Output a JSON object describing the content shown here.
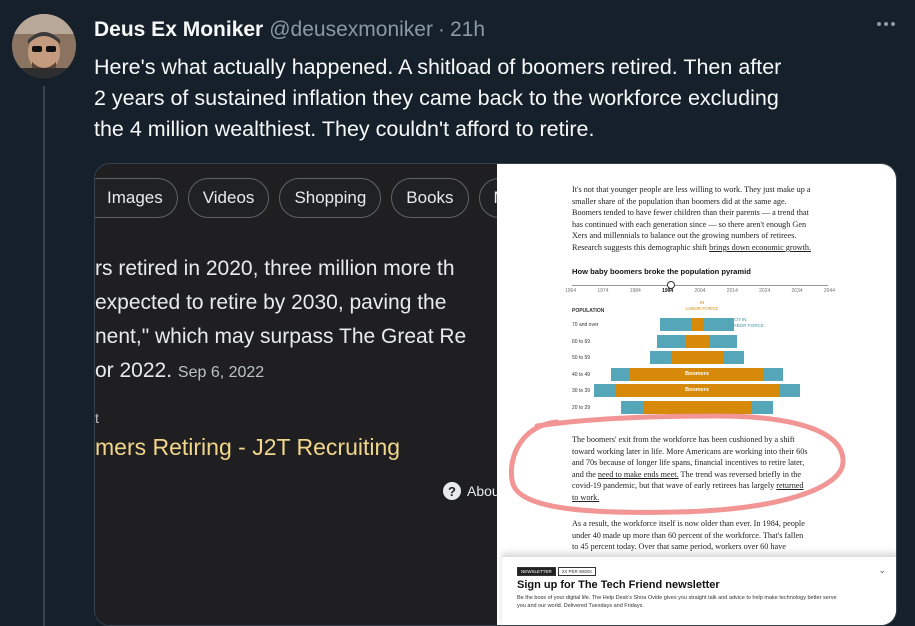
{
  "tweet": {
    "author_name": "Deus Ex Moniker",
    "handle": "@deusexmoniker",
    "separator": "·",
    "time": "21h",
    "text_lines": [
      "Here's what actually happened.  A shitload of boomers retired.  Then after",
      "2 years of sustained inflation they came back to the workforce excluding",
      "the 4 million wealthiest.  They couldn't afford to retire."
    ]
  },
  "google_panel": {
    "chips": [
      "Images",
      "Videos",
      "Shopping",
      "Books",
      "Ma"
    ],
    "snippet_lines": [
      "rs retired in 2020, three million more th",
      " expected to retire by 2030, paving the",
      "nent,\" which may surpass The Great Re",
      "or 2022."
    ],
    "snippet_date": "Sep 6, 2022",
    "small_text": "t",
    "result_link": "mers Retiring - J2T Recruiting",
    "about_label": "Abou"
  },
  "article": {
    "para1_lines": [
      "It's not that younger people are less willing to work. They just make up a",
      "smaller share of the population than boomers did at the same age.",
      "Boomers tended to have fewer children than their parents — a trend that",
      "has continued with each generation since — so there aren't enough Gen",
      "Xers and millennials to balance out the growing numbers of retirees.",
      "Research suggests this demographic shift"
    ],
    "para1_link": "brings down economic growth.",
    "chart_title": "How baby boomers broke the population pyramid",
    "years": [
      "1964",
      "1974",
      "1984",
      "1994",
      "2004",
      "2014",
      "2024",
      "2034",
      "2044"
    ],
    "selected_year": "1994",
    "population_label": "POPULATION",
    "in_labor_force": "IN\nLABOR FORCE",
    "not_in_labor_force": "NOT IN\nLABOR FORCE",
    "age_groups": [
      "70 and over",
      "60 to 69",
      "50 to 59",
      "40 to 49",
      "30 to 39",
      "20 to 29"
    ],
    "boomers_label": "Boomers",
    "para2_lines": [
      "The boomers' exit from the workforce has been cushioned by a shift",
      "toward working later in life. More Americans are working into their 60s",
      "and 70s because of longer life spans, financial incentives to retire later,",
      "and the",
      "The trend was reversed briefly in the",
      "covid-19 pandemic, but that wave of early retirees has largely"
    ],
    "para2_link1": "need to make ends meet.",
    "para2_link2a": "returned",
    "para2_link2b": "to work.",
    "para3_lines": [
      "As a result, the workforce itself is now older than ever. In 1984, people",
      "under 40 made up more than 60 percent of the workforce. That's fallen",
      "to 45 percent today. Over that same period, workers over 60 have"
    ],
    "pyramid": {
      "title": "How baby boomers broke the population pyramid",
      "age_groups": [
        "70 and over",
        "60 to 69",
        "50 to 59",
        "40 to 49",
        "30 to 39",
        "20 to 29"
      ],
      "in_labor_force_share": [
        0.15,
        0.3,
        0.55,
        0.78,
        0.8,
        0.72
      ],
      "relative_size": [
        0.35,
        0.38,
        0.45,
        0.82,
        0.98,
        0.72
      ],
      "boomer_groups": [
        "40 to 49",
        "30 to 39"
      ]
    }
  },
  "newsletter": {
    "badge1": "NEWSLETTER",
    "badge2": "2X PER WEEK",
    "title": "Sign up for The Tech Friend newsletter",
    "desc_lines": [
      "Be the boss of your digital life. The Help Desk's Shira Ovide gives you straight talk and advice to help make technology better serve",
      "you and our world. Delivered Tuesdays and Fridays."
    ],
    "close_icon": "chevron-down-icon"
  },
  "colors": {
    "background": "#15202b",
    "in_labor_force": "#d7890a",
    "not_in_labor_force": "#56a6b9",
    "highlight_circle": "#f08a8a",
    "link_yellow": "#f0d58a"
  }
}
